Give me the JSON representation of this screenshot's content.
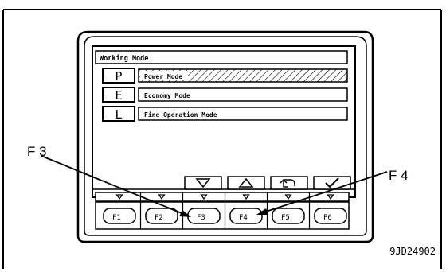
{
  "screen": {
    "title": "Working Mode",
    "modes": [
      {
        "key": "P",
        "label": "Power Mode",
        "selected": true
      },
      {
        "key": "E",
        "label": "Economy Mode",
        "selected": false
      },
      {
        "key": "L",
        "label": "Fine Operation Mode",
        "selected": false
      }
    ],
    "guidance_icons": [
      "down-triangle-icon",
      "up-triangle-icon",
      "return-icon",
      "check-icon"
    ]
  },
  "keys": [
    "F1",
    "F2",
    "F3",
    "F4",
    "F5",
    "F6"
  ],
  "callouts": {
    "left": "F 3",
    "right": "F 4"
  },
  "figure_code": "9JD24902"
}
